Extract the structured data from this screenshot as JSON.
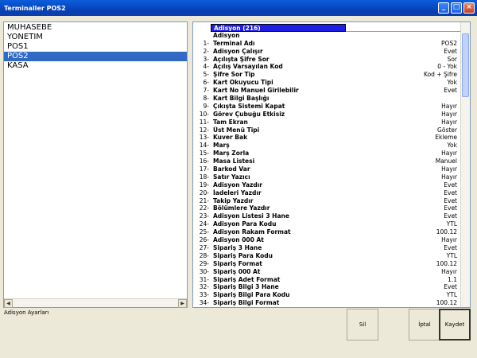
{
  "window": {
    "title": "Terminaller POS2"
  },
  "left_list": {
    "items": [
      "MUHASEBE",
      "YONETIM",
      "POS1",
      "POS2",
      "KASA"
    ],
    "selected_index": 3
  },
  "grid": {
    "header": "Adisyon (216)",
    "group": "Adisyon",
    "rows": [
      {
        "n": "1-",
        "name": "Terminal Adı",
        "val": "POS2"
      },
      {
        "n": "2-",
        "name": "Adisyon Çalışır",
        "val": "Evet"
      },
      {
        "n": "3-",
        "name": "Açılışta Şifre Sor",
        "val": "Sor"
      },
      {
        "n": "4-",
        "name": "Açılış Varsayılan Kod",
        "val": "0 - Yok"
      },
      {
        "n": "5-",
        "name": "Şifre Sor Tip",
        "val": "Kod + Şifre"
      },
      {
        "n": "6-",
        "name": "Kart Okuyucu Tipi",
        "val": "Yok"
      },
      {
        "n": "7-",
        "name": "Kart No Manuel Girilebilir",
        "val": "Evet"
      },
      {
        "n": "8-",
        "name": "Kart Bilgi Başlığı",
        "val": ""
      },
      {
        "n": "9-",
        "name": "Çıkışta Sistemi Kapat",
        "val": "Hayır"
      },
      {
        "n": "10-",
        "name": "Görev Çubuğu Etkisiz",
        "val": "Hayır"
      },
      {
        "n": "11-",
        "name": "Tam Ekran",
        "val": "Hayır"
      },
      {
        "n": "12-",
        "name": "Üst Menü Tipi",
        "val": "Göster"
      },
      {
        "n": "13-",
        "name": "Kuver Bak",
        "val": "Ekleme"
      },
      {
        "n": "14-",
        "name": "Marş",
        "val": "Yok"
      },
      {
        "n": "15-",
        "name": "Marş Zorla",
        "val": "Hayır"
      },
      {
        "n": "16-",
        "name": "Masa Listesi",
        "val": "Manuel"
      },
      {
        "n": "17-",
        "name": "Barkod Var",
        "val": "Hayır"
      },
      {
        "n": "18-",
        "name": "Satır Yazıcı",
        "val": "Hayır"
      },
      {
        "n": "19-",
        "name": "Adisyon Yazdır",
        "val": "Evet"
      },
      {
        "n": "20-",
        "name": "İadeleri Yazdır",
        "val": "Evet"
      },
      {
        "n": "21-",
        "name": "Takip Yazdır",
        "val": "Evet"
      },
      {
        "n": "22-",
        "name": "Bölümlere Yazdır",
        "val": "Evet"
      },
      {
        "n": "23-",
        "name": "Adisyon Listesi 3 Hane",
        "val": "Evet"
      },
      {
        "n": "24-",
        "name": "Adisyon Para Kodu",
        "val": "YTL"
      },
      {
        "n": "25-",
        "name": "Adisyon Rakam Format",
        "val": "100.12"
      },
      {
        "n": "26-",
        "name": "Adisyon 000 At",
        "val": "Hayır"
      },
      {
        "n": "27-",
        "name": "Sipariş 3 Hane",
        "val": "Evet"
      },
      {
        "n": "28-",
        "name": "Sipariş Para Kodu",
        "val": "YTL"
      },
      {
        "n": "29-",
        "name": "Sipariş Format",
        "val": "100.12"
      },
      {
        "n": "30-",
        "name": "Sipariş 000 At",
        "val": "Hayır"
      },
      {
        "n": "31-",
        "name": "Sipariş Adet Format",
        "val": "1.1"
      },
      {
        "n": "32-",
        "name": "Sipariş Bilgi 3 Hane",
        "val": "Evet"
      },
      {
        "n": "33-",
        "name": "Sipariş Bilgi Para Kodu",
        "val": "YTL"
      },
      {
        "n": "34-",
        "name": "Sipariş Bilgi Format",
        "val": "100.12"
      }
    ]
  },
  "status": {
    "text": "Adisyon Ayarları"
  },
  "buttons": {
    "sil": "Sil",
    "iptal": "İptal",
    "kaydet": "Kaydet"
  },
  "icons": {
    "minimize": "minimize-icon",
    "maximize": "maximize-icon",
    "close": "close-icon"
  }
}
